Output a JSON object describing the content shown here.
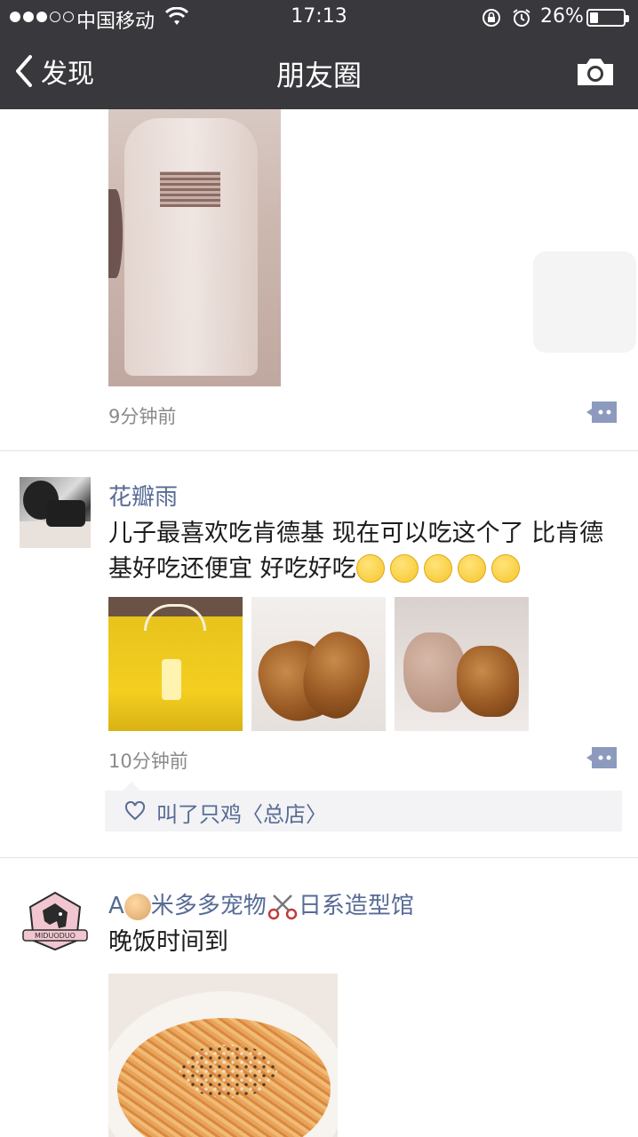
{
  "status_bar": {
    "carrier": "中国移动",
    "time": "17:13",
    "battery": "26%",
    "battery_level": 0.26
  },
  "nav": {
    "back_label": "发现",
    "title": "朋友圈"
  },
  "posts": [
    {
      "time": "9分钟前"
    },
    {
      "name": "花瓣雨",
      "text": "儿子最喜欢吃肯德基 现在可以吃这个了  比肯德基好吃还便宜 好吃好吃",
      "emoji_count": 5,
      "time": "10分钟前",
      "likes": "叫了只鸡〈总店〉"
    },
    {
      "name_prefix": "A",
      "name_middle": "米多多宠物",
      "name_suffix": "日系造型馆",
      "avatar_text": "MIDUODUO",
      "text": "晚饭时间到"
    }
  ],
  "icons": {
    "back": "chevron-left-icon",
    "camera": "camera-icon",
    "comment": "comment-icon",
    "like": "heart-icon"
  },
  "colors": {
    "nav_bg": "#38383d",
    "name_link": "#576b95",
    "like_bar_bg": "#f3f3f5"
  }
}
